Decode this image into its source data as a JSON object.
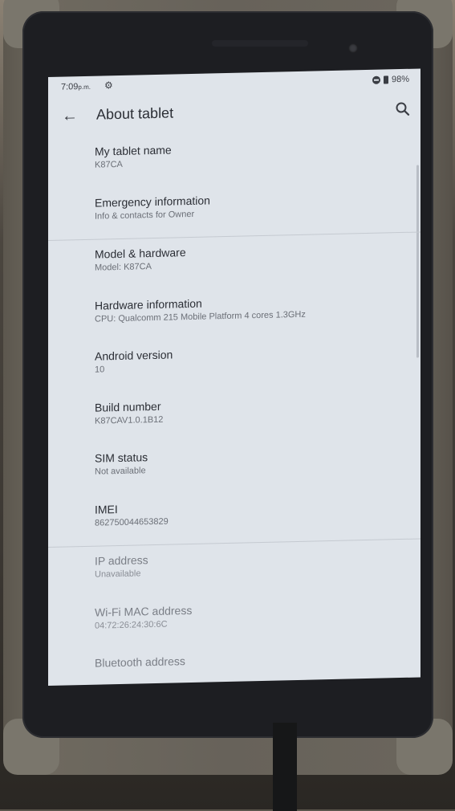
{
  "status_bar": {
    "time": "7:09",
    "time_suffix": "p.m.",
    "battery": "98%"
  },
  "app_bar": {
    "title": "About tablet"
  },
  "items": [
    {
      "title": "My tablet name",
      "summary": "K87CA"
    },
    {
      "title": "Emergency information",
      "summary": "Info & contacts for Owner"
    },
    {
      "title": "Model & hardware",
      "summary": "Model: K87CA"
    },
    {
      "title": "Hardware information",
      "summary": "CPU: Qualcomm 215 Mobile Platform 4 cores 1.3GHz"
    },
    {
      "title": "Android version",
      "summary": "10"
    },
    {
      "title": "Build number",
      "summary": "K87CAV1.0.1B12"
    },
    {
      "title": "SIM status",
      "summary": "Not available"
    },
    {
      "title": "IMEI",
      "summary": "862750044653829"
    },
    {
      "title": "IP address",
      "summary": "Unavailable"
    },
    {
      "title": "Wi-Fi MAC address",
      "summary": "04:72:26:24:30:6C"
    },
    {
      "title": "Bluetooth address",
      "summary": ""
    }
  ],
  "colors": {
    "screen_bg": "#dfe4ea",
    "text_primary": "#2b2e35",
    "text_secondary": "#6b6f77"
  },
  "icons": {
    "back": "arrow-back-icon",
    "search": "search-icon",
    "settings": "gear-icon",
    "battery": "battery-icon",
    "dnd": "do-not-disturb-icon"
  }
}
